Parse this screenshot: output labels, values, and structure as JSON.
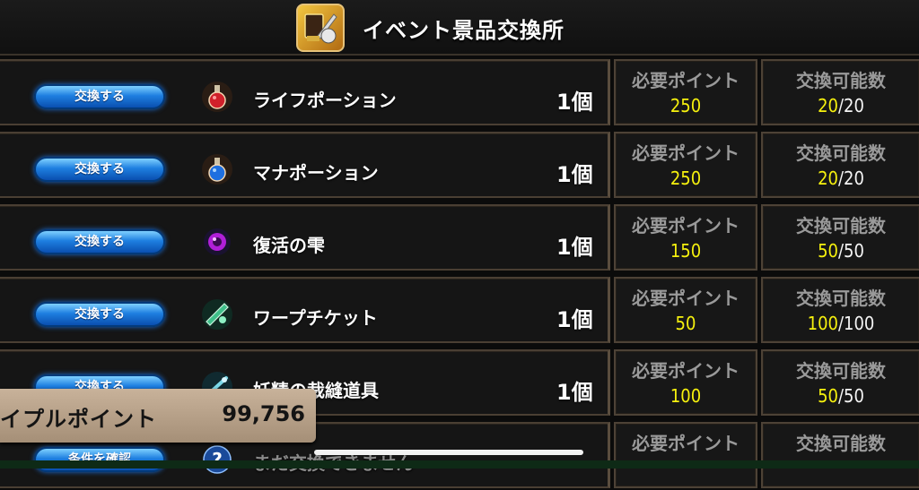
{
  "header": {
    "title": "イベント景品交換所",
    "icon": "shop-icon"
  },
  "labels": {
    "required_points": "必要ポイント",
    "exchangeable_count": "交換可能数"
  },
  "rows": [
    {
      "button": "交換する",
      "icon": "red-potion-icon",
      "name": "ライフポーション",
      "qty": "1個",
      "points": "250",
      "remaining": "20",
      "limit": "/20"
    },
    {
      "button": "交換する",
      "icon": "blue-potion-icon",
      "name": "マナポーション",
      "qty": "1個",
      "points": "250",
      "remaining": "20",
      "limit": "/20"
    },
    {
      "button": "交換する",
      "icon": "purple-orb-icon",
      "name": "復活の雫",
      "qty": "1個",
      "points": "150",
      "remaining": "50",
      "limit": "/50"
    },
    {
      "button": "交換する",
      "icon": "warp-ticket-icon",
      "name": "ワープチケット",
      "qty": "1個",
      "points": "50",
      "remaining": "100",
      "limit": "/100"
    },
    {
      "button": "交換する",
      "icon": "sewing-tool-icon",
      "name": "妖精の裁縫道具",
      "qty": "1個",
      "points": "100",
      "remaining": "50",
      "limit": "/50"
    },
    {
      "button": "条件を確認",
      "icon": "question-icon",
      "name": "まだ交換できません",
      "qty": "",
      "points": "",
      "remaining": "",
      "limit": ""
    }
  ],
  "points_panel": {
    "label": "イプルポイント",
    "value": "99,756"
  },
  "colors": {
    "button_blue": "#1e7fe0",
    "points_yellow": "#f6f10e",
    "panel_tan": "#b8a28a"
  }
}
